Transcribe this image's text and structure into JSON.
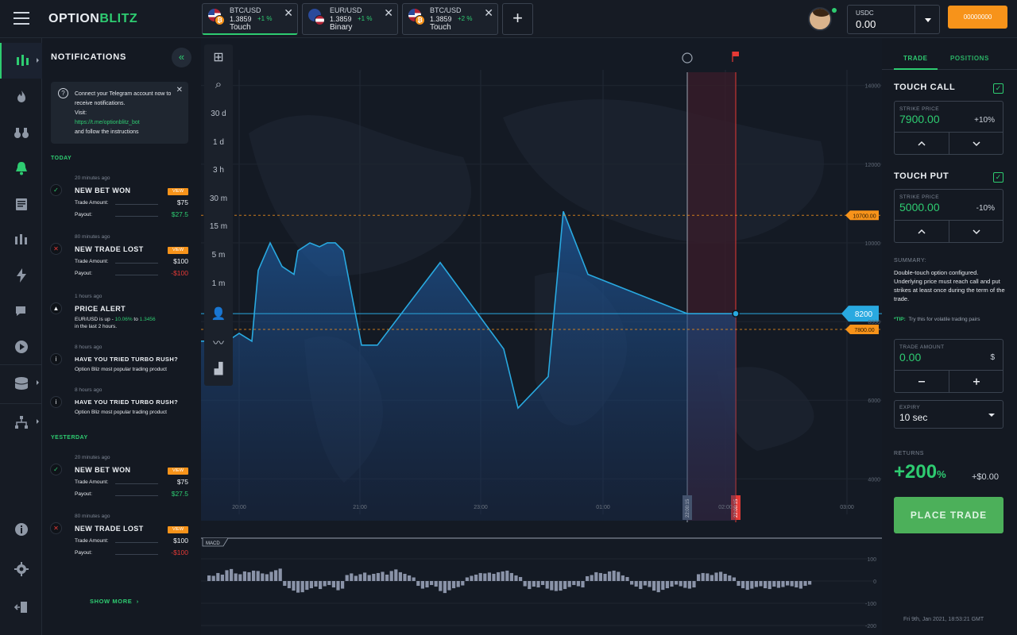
{
  "header": {
    "logo_a": "OPTION",
    "logo_b": "BLITZ",
    "asset_tabs": [
      {
        "pair": "BTC/USD",
        "price": "1.3859",
        "change": "+1 %",
        "type": "Touch"
      },
      {
        "pair": "EUR/USD",
        "price": "1.3859",
        "change": "+1 %",
        "type": "Binary"
      },
      {
        "pair": "BTC/USD",
        "price": "1.3859",
        "change": "+2 %",
        "type": "Touch"
      }
    ],
    "add_tab_label": "+",
    "balance_currency": "USDC",
    "balance_value": "0.00",
    "deposit_label": "00000000"
  },
  "notifications": {
    "title": "NOTIFICATIONS",
    "collapse_icon": "«",
    "telegram": {
      "line1": "Connect your Telegram account now to receive notifications.",
      "line2": "Visit:",
      "link": "https://t.me/optionblitz_bot",
      "line3": "and follow the instructions"
    },
    "today_label": "TODAY",
    "yesterday_label": "YESTERDAY",
    "items": [
      {
        "time": "20 minutes ago",
        "title": "NEW BET WON",
        "view": "VIEW",
        "amount_label": "Trade Amount:",
        "amount": "$75",
        "payout_label": "Payout:",
        "payout": "$27.5"
      },
      {
        "time": "80 minutes ago",
        "title": "NEW TRADE LOST",
        "view": "VIEW",
        "amount_label": "Trade Amount:",
        "amount": "$100",
        "payout_label": "Payout:",
        "payout": "-$100"
      },
      {
        "time": "1 hours ago",
        "title": "PRICE ALERT",
        "text_a": "EUR/USD is up - ",
        "text_b": "10.06%",
        "text_c": " to ",
        "text_d": "1.3456",
        "text_e": "in the last 2 hours."
      },
      {
        "time": "8 hours ago",
        "title": "HAVE YOU TRIED TURBO RUSH?",
        "text": "Option Bliz most popular trading product"
      },
      {
        "time": "8 hours ago",
        "title": "HAVE YOU TRIED TURBO RUSH?",
        "text": "Option Bliz most popular trading product"
      },
      {
        "time": "20 minutes ago",
        "title": "NEW BET WON",
        "view": "VIEW",
        "amount_label": "Trade Amount:",
        "amount": "$75",
        "payout_label": "Payout:",
        "payout": "$27.5"
      },
      {
        "time": "80 minutes ago",
        "title": "NEW TRADE LOST",
        "view": "VIEW",
        "amount_label": "Trade Amount:",
        "amount": "$100",
        "payout_label": "Payout:",
        "payout": "-$100"
      }
    ],
    "show_more": "SHOW MORE"
  },
  "chart_tools": [
    "30 d",
    "1 d",
    "3 h",
    "30 m",
    "15 m",
    "5 m",
    "1 m"
  ],
  "chart_data": {
    "type": "area",
    "x_ticks": [
      "20:00",
      "21:00",
      "23:00",
      "01:00",
      "02:00",
      "03:00"
    ],
    "y_ticks": [
      "14000",
      "12000",
      "10000",
      "8000",
      "6000",
      "4000"
    ],
    "ylim": [
      3300,
      14600
    ],
    "price_line": [
      7500,
      7500,
      7700,
      7500,
      9300,
      10000,
      9400,
      9200,
      9800,
      10000,
      9900,
      10000,
      10000,
      9800,
      7400,
      7400,
      9500,
      7300,
      5800,
      6600,
      10800,
      9200,
      8200,
      8200
    ],
    "current_price": "8200",
    "strike_high": "10700.00",
    "strike_low": "7800.00",
    "window_start": "22:00:15",
    "window_end": "22:00:15",
    "macd_label": "MACD",
    "macd_ticks": [
      "100",
      "0",
      "-100",
      "-200"
    ],
    "macd_values": [
      28,
      26,
      40,
      32,
      54,
      60,
      38,
      34,
      48,
      44,
      52,
      50,
      38,
      34,
      46,
      54,
      62,
      -24,
      -36,
      -48,
      -58,
      -56,
      -44,
      -36,
      -28,
      -40,
      -26,
      -20,
      -32,
      -46,
      -38,
      30,
      38,
      26,
      34,
      42,
      30,
      36,
      40,
      46,
      32,
      50,
      58,
      44,
      36,
      28,
      18,
      -24,
      -38,
      -32,
      -20,
      -28,
      -50,
      -60,
      -46,
      -36,
      -30,
      -22,
      18,
      26,
      32,
      40,
      38,
      42,
      36,
      44,
      48,
      52,
      40,
      28,
      20,
      -26,
      -40,
      -28,
      -32,
      -20,
      -38,
      -46,
      -50,
      -48,
      -40,
      -30,
      -20,
      -26,
      -32,
      24,
      30,
      44,
      40,
      36,
      48,
      52,
      46,
      28,
      20,
      -18,
      -28,
      -40,
      -22,
      -30,
      -48,
      -56,
      -44,
      -36,
      -28,
      -18,
      -26,
      -34,
      -38,
      -32,
      34,
      40,
      38,
      30,
      42,
      46,
      36,
      28,
      18,
      -24,
      -36,
      -44,
      -38,
      -30,
      -26,
      -36,
      -40,
      -28,
      -34,
      -30,
      -22,
      -26,
      -32,
      -38,
      -24,
      -18
    ]
  },
  "trade_panel": {
    "tab_trade": "TRADE",
    "tab_positions": "POSITIONS",
    "touch_call": {
      "title": "TOUCH CALL",
      "label": "STRIKE PRICE",
      "value": "7900.00",
      "pct": "+10%"
    },
    "touch_put": {
      "title": "TOUCH PUT",
      "label": "STRIKE PRICE",
      "value": "5000.00",
      "pct": "-10%"
    },
    "summary_title": "SUMMARY:",
    "summary_text": "Double-touch option configured. Underlying price must reach call and put strikes at least once during the term of the trade.",
    "tip_label": "*TIP:",
    "tip_text": "Try this for volatile trading pairs",
    "amount_label": "TRADE AMOUNT",
    "amount_value": "0.00",
    "amount_unit": "$",
    "expiry_label": "EXPIRY",
    "expiry_value": "10 sec",
    "returns_label": "RETURNS",
    "returns_value": "+200",
    "returns_pct": "%",
    "returns_usd": "+$0.00",
    "place_trade": "PLACE TRADE",
    "datetime": "Fri 9th, Jan 2021, 18:53:21 GMT"
  },
  "colors": {
    "accent": "#2ecc71",
    "orange": "#f7931a",
    "line": "#29a9e0",
    "red": "#e53935"
  }
}
